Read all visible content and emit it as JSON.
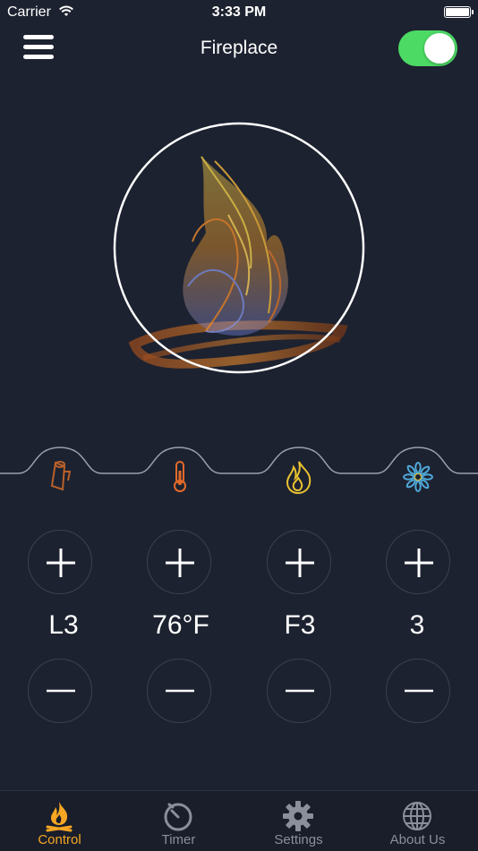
{
  "status_bar": {
    "carrier": "Carrier",
    "time": "3:33 PM"
  },
  "header": {
    "title": "Fireplace",
    "power_on": true
  },
  "controls": [
    {
      "icon": "log-icon",
      "value": "L3"
    },
    {
      "icon": "thermometer-icon",
      "value": "76°F"
    },
    {
      "icon": "flame-icon",
      "value": "F3"
    },
    {
      "icon": "fan-icon",
      "value": "3"
    }
  ],
  "tabs": [
    {
      "label": "Control",
      "icon": "campfire-icon",
      "active": true
    },
    {
      "label": "Timer",
      "icon": "timer-icon",
      "active": false
    },
    {
      "label": "Settings",
      "icon": "gear-icon",
      "active": false
    },
    {
      "label": "About Us",
      "icon": "globe-icon",
      "active": false
    }
  ],
  "colors": {
    "background": "#1d2230",
    "toggle_on": "#4cd964",
    "accent": "#f5a623",
    "inactive": "#8a8f9b"
  }
}
